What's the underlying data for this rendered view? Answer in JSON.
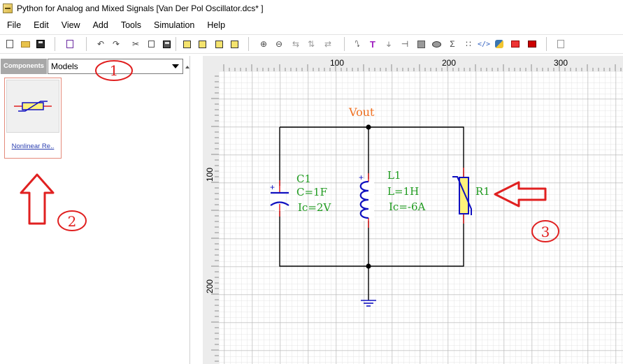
{
  "window": {
    "title": "Python for Analog and Mixed Signals [Van Der Pol Oscillator.dcs* ]"
  },
  "menu": [
    "File",
    "Edit",
    "View",
    "Add",
    "Tools",
    "Simulation",
    "Help"
  ],
  "toolbar": {
    "icons": [
      "new-file-icon",
      "open-folder-icon",
      "save-icon",
      "add-part-icon",
      "undo-icon",
      "redo-icon",
      "cut-icon",
      "copy-icon",
      "paste-icon",
      "bring-front-icon",
      "send-back-icon",
      "bring-forward-icon",
      "send-backward-icon",
      "zoom-in-icon",
      "zoom-out-icon",
      "flip-horizontal-icon",
      "flip-vertical-icon",
      "pointer-icon",
      "text-icon",
      "ground-icon",
      "probe-icon",
      "rectangle-icon",
      "ellipse-icon",
      "sigma-icon",
      "nodes-icon",
      "code-icon",
      "python-icon",
      "run-icon",
      "stop-icon",
      "generate-icon"
    ]
  },
  "components_panel": {
    "header": "Components",
    "selected_library": "Models",
    "items": [
      {
        "label": "Nonlinear Re.."
      }
    ]
  },
  "ruler": {
    "top_labels": [
      "100",
      "200",
      "300"
    ],
    "left_labels": [
      "100",
      "200"
    ]
  },
  "schematic": {
    "net_label": "Vout",
    "capacitor": {
      "name": "C1",
      "value": "C=1F",
      "ic": "Ic=2V"
    },
    "inductor": {
      "name": "L1",
      "value": "L=1H",
      "ic": "Ic=-6A"
    },
    "resistor": {
      "name": "R1"
    }
  },
  "annotations": [
    "1",
    "2",
    "3"
  ],
  "colors": {
    "annotation_red": "#e02020",
    "net_label_orange": "#f07020",
    "component_label_green": "#1e9a1e",
    "component_blue": "#1010c0",
    "resistor_fill": "#fff27a",
    "wire": "#000000",
    "grid_minor": "#dcdcdc",
    "grid_major": "#a8a8a8"
  }
}
